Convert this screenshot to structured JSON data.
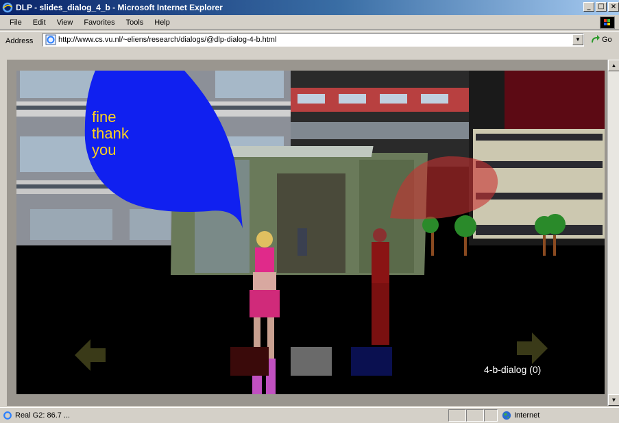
{
  "window": {
    "title": "DLP - slides_dialog_4_b - Microsoft Internet Explorer",
    "minimize": "_",
    "maximize": "□",
    "close": "×"
  },
  "menu": [
    "File",
    "Edit",
    "View",
    "Favorites",
    "Tools",
    "Help"
  ],
  "address": {
    "label": "Address",
    "url": "http://www.cs.vu.nl/~eliens/research/dialogs/@dlp-dialog-4-b.html",
    "go_label": "Go"
  },
  "scene": {
    "speech_lines": [
      "fine",
      "thank",
      "you"
    ],
    "dialog_label": "4-b-dialog (0)"
  },
  "status": {
    "text": "Real G2: 86.7 ...",
    "zone": "Internet"
  },
  "colors": {
    "titlebar_start": "#0a246a",
    "bubble_blue": "#1020f0",
    "bubble_red": "#c83232",
    "speech_text": "#ffd21e"
  },
  "icons": {
    "app": "ie-icon",
    "page": "ie-page-icon",
    "go": "go-arrow-icon",
    "zone": "globe-icon"
  }
}
